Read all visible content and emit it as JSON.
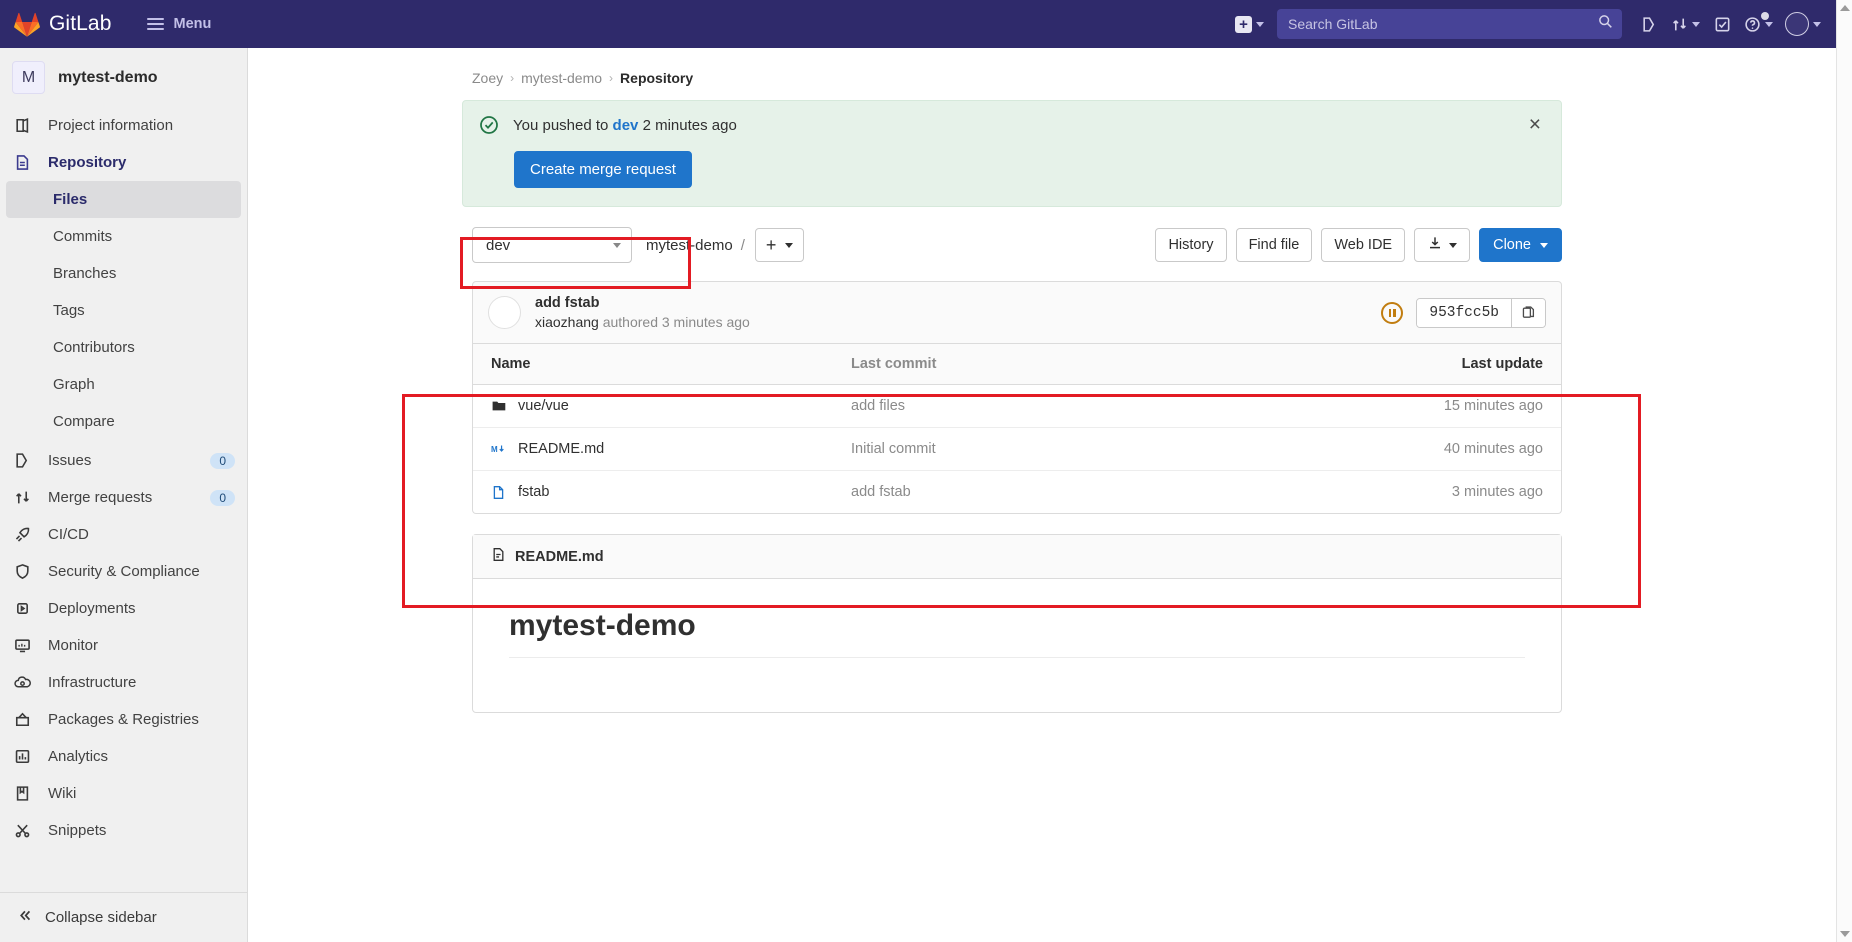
{
  "topnav": {
    "brand": "GitLab",
    "menu_label": "Menu",
    "new_label": "new-dropdown",
    "search_placeholder": "Search GitLab",
    "search_value": "",
    "icons": [
      {
        "name": "issues-icon",
        "label": "Issues"
      },
      {
        "name": "merge-requests-icon",
        "label": "Merge requests"
      },
      {
        "name": "todos-icon",
        "label": "To-Do List"
      },
      {
        "name": "help-icon",
        "label": "Help"
      },
      {
        "name": "user-avatar",
        "label": "User menu"
      }
    ]
  },
  "sidebar": {
    "project": {
      "initial": "M",
      "name": "mytest-demo"
    },
    "items": [
      {
        "label": "Project information",
        "icon": "project-info-icon",
        "badge": null,
        "active": false
      },
      {
        "label": "Repository",
        "icon": "repository-icon",
        "badge": null,
        "active": true
      },
      {
        "label": "Issues",
        "icon": "issues-icon",
        "badge": "0",
        "active": false
      },
      {
        "label": "Merge requests",
        "icon": "merge-requests-icon",
        "badge": "0",
        "active": false
      },
      {
        "label": "CI/CD",
        "icon": "rocket-icon",
        "badge": null,
        "active": false
      },
      {
        "label": "Security & Compliance",
        "icon": "shield-icon",
        "badge": null,
        "active": false
      },
      {
        "label": "Deployments",
        "icon": "deployments-icon",
        "badge": null,
        "active": false
      },
      {
        "label": "Monitor",
        "icon": "monitor-icon",
        "badge": null,
        "active": false
      },
      {
        "label": "Infrastructure",
        "icon": "cloud-gear-icon",
        "badge": null,
        "active": false
      },
      {
        "label": "Packages & Registries",
        "icon": "package-icon",
        "badge": null,
        "active": false
      },
      {
        "label": "Analytics",
        "icon": "chart-icon",
        "badge": null,
        "active": false
      },
      {
        "label": "Wiki",
        "icon": "book-icon",
        "badge": null,
        "active": false
      },
      {
        "label": "Snippets",
        "icon": "snippet-icon",
        "badge": null,
        "active": false
      }
    ],
    "repository_subitems": [
      {
        "label": "Files",
        "selected": true
      },
      {
        "label": "Commits",
        "selected": false
      },
      {
        "label": "Branches",
        "selected": false
      },
      {
        "label": "Tags",
        "selected": false
      },
      {
        "label": "Contributors",
        "selected": false
      },
      {
        "label": "Graph",
        "selected": false
      },
      {
        "label": "Compare",
        "selected": false
      }
    ],
    "collapse_label": "Collapse sidebar"
  },
  "breadcrumb": {
    "owner": "Zoey",
    "project": "mytest-demo",
    "current": "Repository",
    "separator": "›"
  },
  "alert": {
    "text_before": "You pushed to ",
    "branch": "dev",
    "text_after": " 2 minutes ago",
    "button_label": "Create merge request",
    "close_label": "×"
  },
  "toolbar": {
    "branch": "dev",
    "repo_path": "mytest-demo",
    "path_separator": "/",
    "add_label": "+",
    "history_label": "History",
    "find_file_label": "Find file",
    "web_ide_label": "Web IDE",
    "download_label": "download-icon",
    "clone_label": "Clone"
  },
  "commit": {
    "title": "add fstab",
    "author": "xiaozhang",
    "meta": "authored 3 minutes ago",
    "pipeline_status": "pending",
    "sha": "953fcc5b",
    "copy_label": "copy-icon"
  },
  "file_table": {
    "headers": {
      "name": "Name",
      "last_commit": "Last commit",
      "last_update": "Last update"
    },
    "rows": [
      {
        "name": "vue/vue",
        "icon": "folder-icon",
        "last_commit": "add files",
        "last_update": "15 minutes ago"
      },
      {
        "name": "README.md",
        "icon": "markdown-icon",
        "last_commit": "Initial commit",
        "last_update": "40 minutes ago"
      },
      {
        "name": "fstab",
        "icon": "file-icon",
        "last_commit": "add fstab",
        "last_update": "3 minutes ago"
      }
    ]
  },
  "readme": {
    "filename": "README.md",
    "heading": "mytest-demo"
  },
  "colors": {
    "brand_navy": "#2f2a6b",
    "accent_blue": "#1f75cb",
    "success_green": "#217645",
    "annotation_red": "#e31b23",
    "pipeline_orange": "#c17d10"
  }
}
